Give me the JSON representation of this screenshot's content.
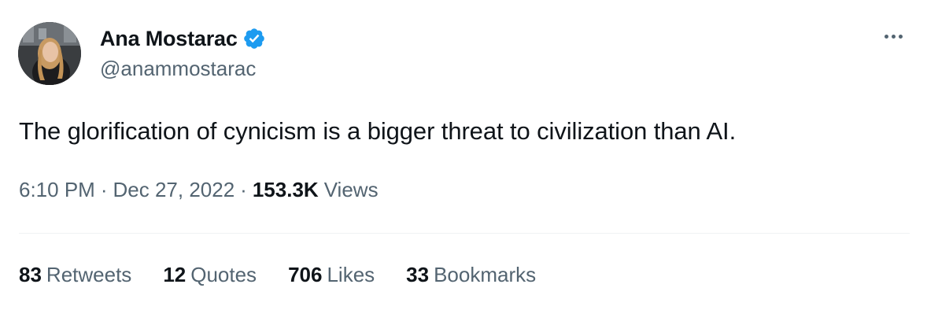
{
  "author": {
    "display_name": "Ana Mostarac",
    "handle": "@anammostarac",
    "verified_icon": "verified-badge-icon",
    "verified_color": "#1d9bf0"
  },
  "more_icon": "more-horizontal-icon",
  "tweet": {
    "text": "The glorification of cynicism is a bigger threat to civilization than AI."
  },
  "meta": {
    "time": "6:10 PM",
    "separator": "·",
    "date": "Dec 27, 2022",
    "views_count": "153.3K",
    "views_label": "Views"
  },
  "stats": [
    {
      "count": "83",
      "label": "Retweets"
    },
    {
      "count": "12",
      "label": "Quotes"
    },
    {
      "count": "706",
      "label": "Likes"
    },
    {
      "count": "33",
      "label": "Bookmarks"
    }
  ],
  "colors": {
    "text_primary": "#0f1419",
    "text_secondary": "#536471",
    "divider": "#eff3f4"
  }
}
